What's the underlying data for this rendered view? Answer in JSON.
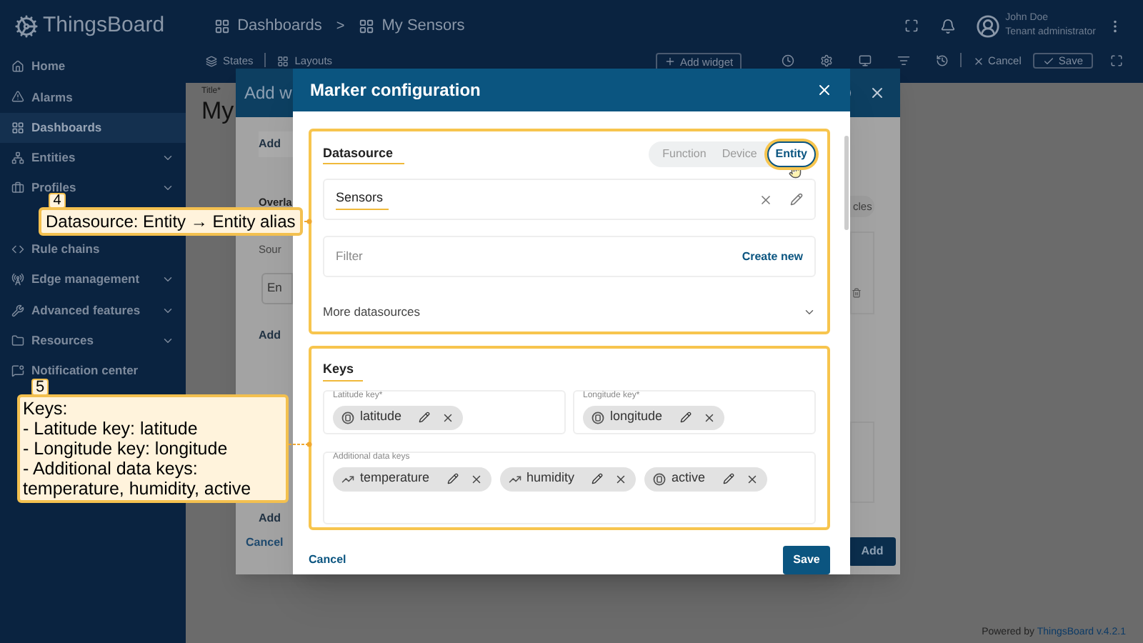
{
  "topbar": {
    "logo": "ThingsBoard",
    "breadcrumbs": [
      {
        "label": "Dashboards"
      },
      {
        "label": "My Sensors"
      }
    ],
    "separator": ">",
    "user": {
      "name": "John Doe",
      "role": "Tenant administrator"
    }
  },
  "sidebar": {
    "items": [
      {
        "label": "Home",
        "expandable": false,
        "selected": false
      },
      {
        "label": "Alarms",
        "expandable": false,
        "selected": false
      },
      {
        "label": "Dashboards",
        "expandable": false,
        "selected": true
      },
      {
        "label": "Entities",
        "expandable": true,
        "selected": false
      },
      {
        "label": "Profiles",
        "expandable": true,
        "selected": false
      },
      {
        "label": "Rule chains",
        "expandable": false,
        "selected": false
      },
      {
        "label": "Edge management",
        "expandable": true,
        "selected": false
      },
      {
        "label": "Advanced features",
        "expandable": true,
        "selected": false
      },
      {
        "label": "Resources",
        "expandable": true,
        "selected": false
      },
      {
        "label": "Notification center",
        "expandable": false,
        "selected": false
      }
    ]
  },
  "toolbar": {
    "states": "States",
    "layouts": "Layouts",
    "add_widget": "Add widget",
    "cancel": "Cancel",
    "save": "Save"
  },
  "dashboard": {
    "title_label": "Title*",
    "title_value": "My"
  },
  "add_widget_dialog": {
    "title": "Add w",
    "add_button": "Add",
    "overlay_heading": "Overla",
    "source_label": "Sour",
    "source_value": "En",
    "add_link": "Add",
    "add_link_2": "Add",
    "chip": "cles",
    "cancel": "Cancel",
    "submit": "Add"
  },
  "marker_dialog": {
    "title": "Marker configuration",
    "datasource": {
      "heading": "Datasource",
      "types": [
        {
          "label": "Function",
          "selected": false
        },
        {
          "label": "Device",
          "selected": false
        },
        {
          "label": "Entity",
          "selected": true
        }
      ],
      "alias": "Sensors",
      "filter_placeholder": "Filter",
      "create_new": "Create new",
      "more": "More datasources"
    },
    "keys": {
      "heading": "Keys",
      "latitude": {
        "label": "Latitude key*",
        "chip": {
          "label": "latitude",
          "kind": "attribute"
        }
      },
      "longitude": {
        "label": "Longitude key*",
        "chip": {
          "label": "longitude",
          "kind": "attribute"
        }
      },
      "additional": {
        "label": "Additional data keys",
        "chips": [
          {
            "label": "temperature",
            "kind": "timeseries"
          },
          {
            "label": "humidity",
            "kind": "timeseries"
          },
          {
            "label": "active",
            "kind": "attribute"
          }
        ]
      }
    },
    "cancel": "Cancel",
    "save": "Save"
  },
  "callouts": [
    {
      "number": "4",
      "lines": [
        "Datasource: Entity → Entity alias"
      ]
    },
    {
      "number": "5",
      "lines": [
        "Keys:",
        "- Latitude key: latitude",
        "- Longitude key: longitude",
        "- Additional data keys: temperature, humidity, active"
      ]
    }
  ],
  "footer": {
    "prefix": "Powered by",
    "link": "ThingsBoard v.4.2.1"
  }
}
